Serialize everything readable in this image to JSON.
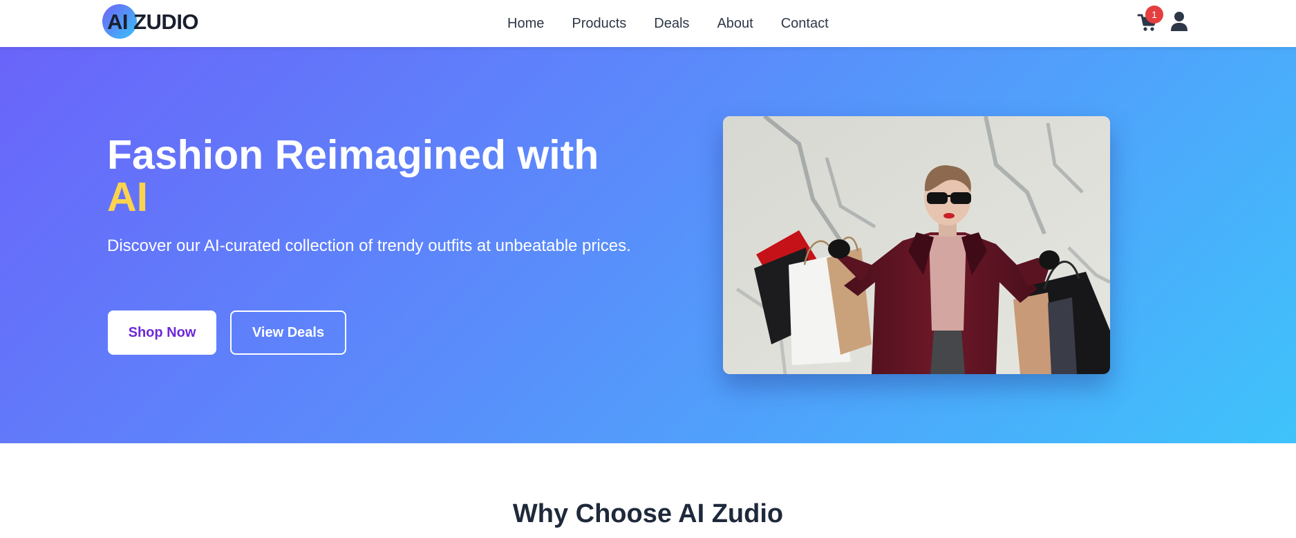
{
  "brand": {
    "logo_text": "AI ZUDIO"
  },
  "nav": {
    "items": [
      "Home",
      "Products",
      "Deals",
      "About",
      "Contact"
    ]
  },
  "header": {
    "cart_count": "1"
  },
  "hero": {
    "title_main": "Fashion Reimagined with",
    "title_accent": "AI",
    "subtitle": "Discover our AI-curated collection of trendy outfits at unbeatable prices.",
    "primary_button": "Shop Now",
    "secondary_button": "View Deals",
    "image_icon": "woman-with-shopping-bags-photo"
  },
  "why": {
    "title": "Why Choose AI Zudio"
  },
  "colors": {
    "gradient_start": "#6a64fa",
    "gradient_end": "#3fc3fb",
    "accent_yellow": "#fcd34d",
    "primary_purple": "#6d28d9",
    "badge_red": "#e53e3e",
    "text_dark": "#1e293b"
  }
}
